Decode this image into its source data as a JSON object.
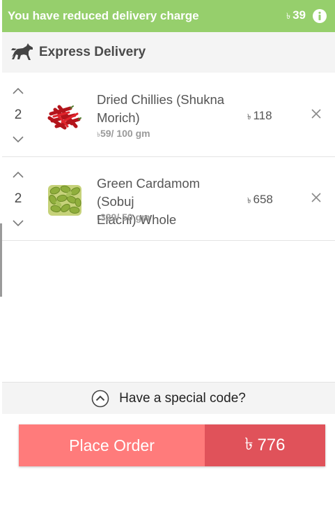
{
  "banner": {
    "message": "You have reduced delivery charge",
    "currency": "৳",
    "amount": "39",
    "icon": "info-icon",
    "color": "#96cf6c"
  },
  "express": {
    "label": "Express Delivery",
    "icon": "horse-icon"
  },
  "cart_items": [
    {
      "quantity": "2",
      "name_line1": "Dried Chillies (Shukna",
      "name_line2": "Morich)",
      "unit_currency": "৳",
      "unit_price": "59/ 100 gm",
      "price_currency": "৳",
      "price": "118"
    },
    {
      "quantity": "2",
      "name_line1": "Green Cardamom (Sobuj",
      "name_line2": "Elachi) Whole",
      "unit_currency": "৳",
      "unit_price": "329/ 50 gm",
      "price_currency": "৳",
      "price": "658"
    }
  ],
  "special_code": {
    "label": "Have a special code?"
  },
  "place_order": {
    "label": "Place Order",
    "currency": "৳",
    "total": "776",
    "colors": {
      "label_bg": "#ff7b7b",
      "total_bg": "#e0525a"
    }
  }
}
